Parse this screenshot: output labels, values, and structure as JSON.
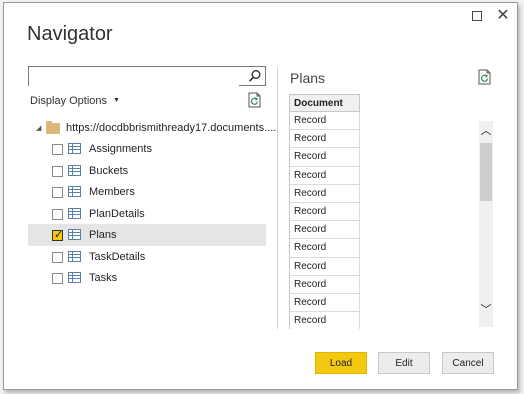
{
  "window": {
    "title": "Navigator"
  },
  "search": {
    "value": "",
    "placeholder": ""
  },
  "display_options_label": "Display Options",
  "tree": {
    "root_label": "https://docdbbrismithready17.documents....",
    "items": [
      {
        "label": "Assignments",
        "checked": false
      },
      {
        "label": "Buckets",
        "checked": false
      },
      {
        "label": "Members",
        "checked": false
      },
      {
        "label": "PlanDetails",
        "checked": false
      },
      {
        "label": "Plans",
        "checked": true
      },
      {
        "label": "TaskDetails",
        "checked": false
      },
      {
        "label": "Tasks",
        "checked": false
      }
    ]
  },
  "preview": {
    "title": "Plans",
    "column_header": "Document",
    "rows": [
      "Record",
      "Record",
      "Record",
      "Record",
      "Record",
      "Record",
      "Record",
      "Record",
      "Record",
      "Record",
      "Record",
      "Record"
    ]
  },
  "buttons": {
    "load": "Load",
    "edit": "Edit",
    "cancel": "Cancel"
  },
  "colors": {
    "accent": "#f2c811",
    "selected_row": "#e5e5e5"
  }
}
